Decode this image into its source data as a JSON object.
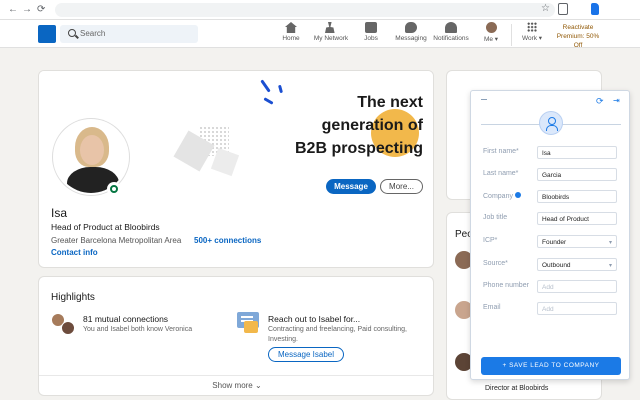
{
  "search": {
    "placeholder": "Search"
  },
  "nav": {
    "items": [
      {
        "label": "Home",
        "icon": "home-icon"
      },
      {
        "label": "My Network",
        "icon": "network-icon"
      },
      {
        "label": "Jobs",
        "icon": "jobs-icon"
      },
      {
        "label": "Messaging",
        "icon": "messaging-icon"
      },
      {
        "label": "Notifications",
        "icon": "bell-icon"
      },
      {
        "label": "Me ▾",
        "icon": "avatar"
      },
      {
        "label": "Work ▾",
        "icon": "grid-icon"
      }
    ],
    "premium": "Reactivate Premium: 50% Off"
  },
  "banner": {
    "line1": "The next",
    "line2": "generation of",
    "line3": "B2B prospecting"
  },
  "profile": {
    "name": "Isa",
    "headline": "Head of Product at Bloobirds",
    "location": "Greater Barcelona Metropolitan Area",
    "connections": "500+ connections",
    "contact": "Contact info",
    "message_button": "Message",
    "more_button": "More..."
  },
  "highlights": {
    "title": "Highlights",
    "mutual_title": "81 mutual connections",
    "mutual_sub": "You and Isabel both know Veronica",
    "reach_title": "Reach out to Isabel for...",
    "reach_sub1": "Contracting and freelancing, Paid consulting,",
    "reach_sub2": "Investing.",
    "message_button": "Message Isabel",
    "show_more": "Show more ⌄"
  },
  "right": {
    "people_heading": "Peo",
    "footer_text": "Director at Bloobirds"
  },
  "panel": {
    "fields": [
      {
        "label": "First name*",
        "value": "Isa",
        "placeholder": false
      },
      {
        "label": "Last name*",
        "value": "Garcia",
        "placeholder": false
      },
      {
        "label": "Company",
        "value": "Bloobirds",
        "placeholder": false
      },
      {
        "label": "Job title",
        "value": "Head of Product",
        "placeholder": false
      },
      {
        "label": "ICP*",
        "value": "Founder",
        "placeholder": false
      },
      {
        "label": "Source*",
        "value": "Outbound",
        "placeholder": false
      },
      {
        "label": "Phone number",
        "value": "Add",
        "placeholder": true
      },
      {
        "label": "Email",
        "value": "Add",
        "placeholder": true
      }
    ],
    "save_button": "+ SAVE LEAD TO COMPANY",
    "accent": "#1b7ae6"
  }
}
